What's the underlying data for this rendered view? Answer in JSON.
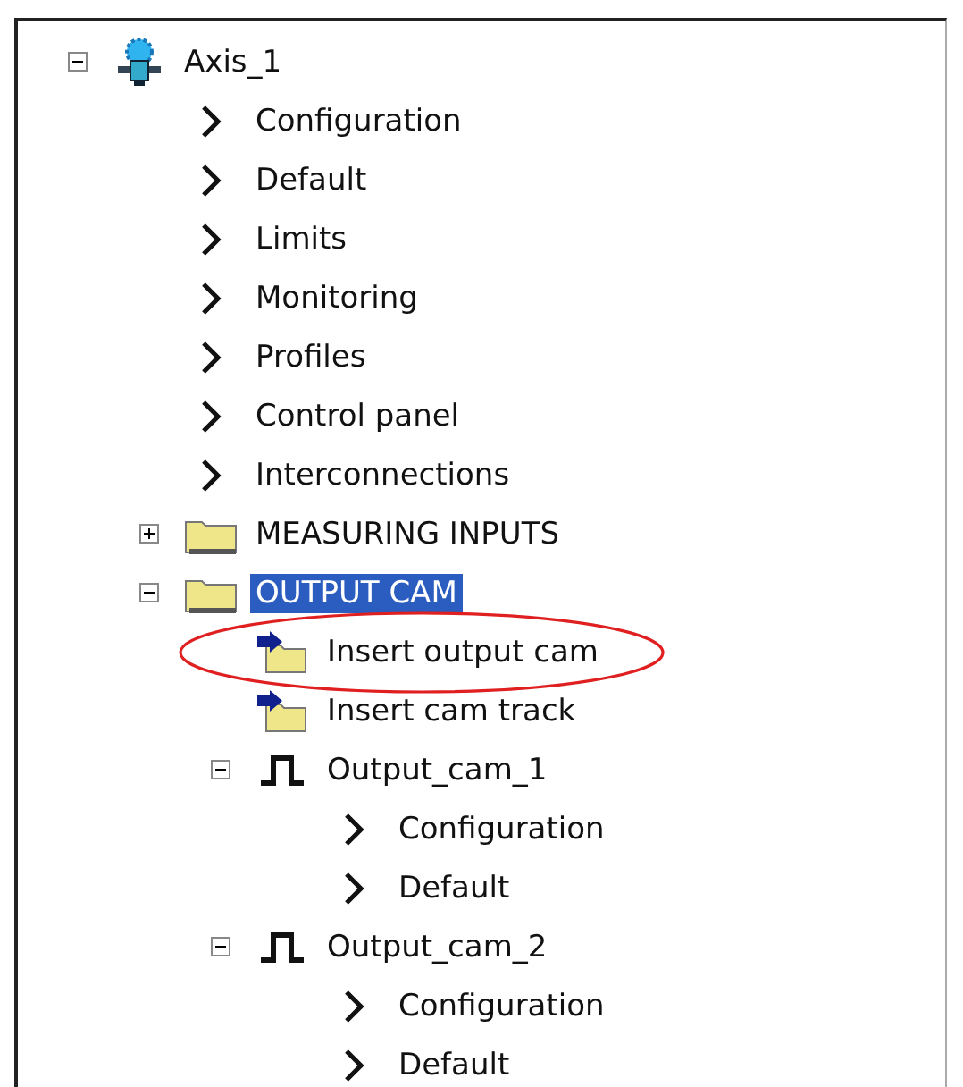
{
  "tree": [
    {
      "kind": "axis",
      "label": "Axis_1",
      "expanded": true,
      "selected": false,
      "children": [
        {
          "kind": "setting",
          "label": "Configuration",
          "selected": false
        },
        {
          "kind": "setting",
          "label": "Default",
          "selected": false
        },
        {
          "kind": "setting",
          "label": "Limits",
          "selected": false
        },
        {
          "kind": "setting",
          "label": "Monitoring",
          "selected": false
        },
        {
          "kind": "setting",
          "label": "Profiles",
          "selected": false
        },
        {
          "kind": "setting",
          "label": "Control panel",
          "selected": false
        },
        {
          "kind": "setting",
          "label": "Interconnections",
          "selected": false
        },
        {
          "kind": "folder",
          "label": "MEASURING INPUTS",
          "expanded": false,
          "selected": false
        },
        {
          "kind": "folder",
          "label": "OUTPUT CAM",
          "expanded": true,
          "selected": true,
          "children": [
            {
              "kind": "action",
              "label": "Insert output cam",
              "selected": false,
              "highlighted": true
            },
            {
              "kind": "action",
              "label": "Insert cam track",
              "selected": false
            },
            {
              "kind": "cam",
              "label": "Output_cam_1",
              "expanded": true,
              "selected": false,
              "children": [
                {
                  "kind": "setting",
                  "label": "Configuration",
                  "selected": false
                },
                {
                  "kind": "setting",
                  "label": "Default",
                  "selected": false
                }
              ]
            },
            {
              "kind": "cam",
              "label": "Output_cam_2",
              "expanded": true,
              "selected": false,
              "children": [
                {
                  "kind": "setting",
                  "label": "Configuration",
                  "selected": false
                },
                {
                  "kind": "setting",
                  "label": "Default",
                  "selected": false
                }
              ]
            }
          ]
        }
      ]
    }
  ]
}
